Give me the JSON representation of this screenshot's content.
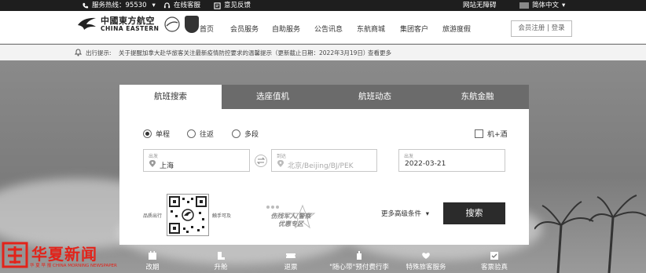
{
  "topbar": {
    "hotline": "服务热线：95530",
    "online_service": "在线客服",
    "feedback": "意见反馈",
    "accessibility": "网站无障碍",
    "language": "简体中文"
  },
  "header": {
    "logo_cn": "中國東方航空",
    "logo_en": "CHINA EASTERN",
    "nav": [
      "首页",
      "会员服务",
      "自助服务",
      "公告讯息",
      "东航商城",
      "集团客户",
      "旅游度假"
    ],
    "login": "会员注册 | 登录"
  },
  "notice": {
    "label": "出行提示:",
    "text": "关于提醒加拿大赴华旅客关注最新疫情防控要求的温馨提示（更新截止日期：2022年3月19日）",
    "more": "查看更多"
  },
  "booking": {
    "tabs": [
      "航班搜索",
      "选座值机",
      "航班动态",
      "东航金融"
    ],
    "trip_types": [
      "单程",
      "往返",
      "多段"
    ],
    "hotel_combo": "机+酒",
    "from_label": "出发",
    "from_value": "上海",
    "to_label": "到达",
    "to_placeholder": "北京/Beijing/BJ/PEK",
    "date_label": "出发",
    "date_value": "2022-03-21",
    "qr_left": "品质出行",
    "qr_right": "触手可及",
    "promo_line1": "伤残军人/警察",
    "promo_line2": "优惠专区",
    "more_options": "更多高级条件",
    "search": "搜索"
  },
  "quick_links": [
    "改期",
    "升舱",
    "退票",
    "\"随心带\"预付费行李",
    "特殊旅客服务",
    "客票验真"
  ],
  "watermark": {
    "title": "华夏新闻",
    "subtitle": "华 夏 早 报 CHINA MORNING NEWSPAPER"
  },
  "colors": {
    "topbar": "#1e1e1e",
    "tab_bar": "#6b6b6b",
    "search_button": "#2b2b2b",
    "watermark": "#e2231a"
  }
}
